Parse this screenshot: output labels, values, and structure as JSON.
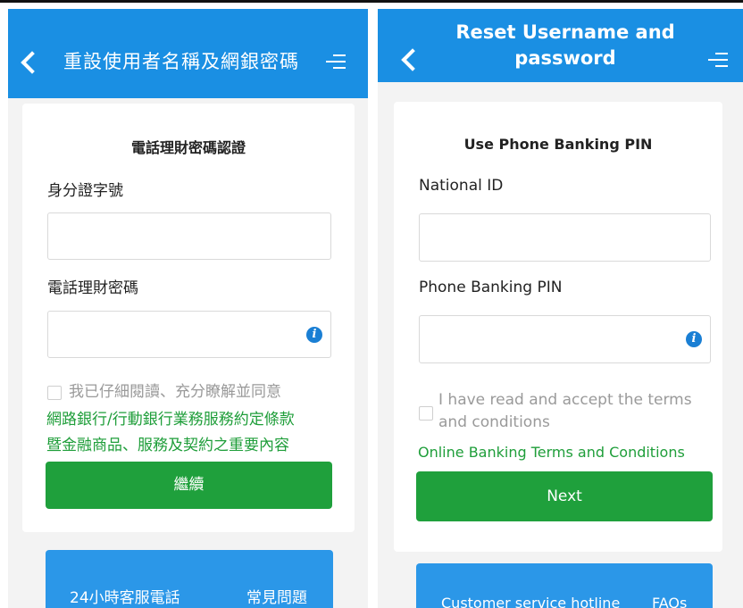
{
  "left": {
    "header": {
      "title": "重設使用者名稱及網銀密碼"
    },
    "card": {
      "title": "電話理財密碼認證",
      "id_label": "身分證字號",
      "pin_label": "電話理財密碼",
      "terms_text": "我已仔細閱讀、充分瞭解並同意",
      "terms_link_line1": "網路銀行/行動銀行業務服務約定條款",
      "terms_link_line2": "暨金融商品、服務及契約之重要內容",
      "continue_label": "繼續"
    },
    "bottom": {
      "hotline": "24小時客服電話",
      "faq": "常見問題"
    }
  },
  "right": {
    "header": {
      "title_line1": "Reset Username and",
      "title_line2": "password"
    },
    "card": {
      "title": "Use Phone Banking PIN",
      "id_label": "National ID",
      "pin_label": "Phone Banking PIN",
      "terms_line1": "I have read and accept the terms",
      "terms_line2": "and conditions",
      "terms_link": "Online Banking Terms and Conditions",
      "next_label": "Next"
    },
    "bottom": {
      "hotline": "Customer service hotline",
      "faq": "FAQs"
    }
  },
  "icons": {
    "info": "i"
  },
  "colors": {
    "header_blue": "#1a8fe3",
    "button_green": "#1fa03c",
    "link_green": "#1f9e3a",
    "footer_blue": "#2b97e8"
  }
}
